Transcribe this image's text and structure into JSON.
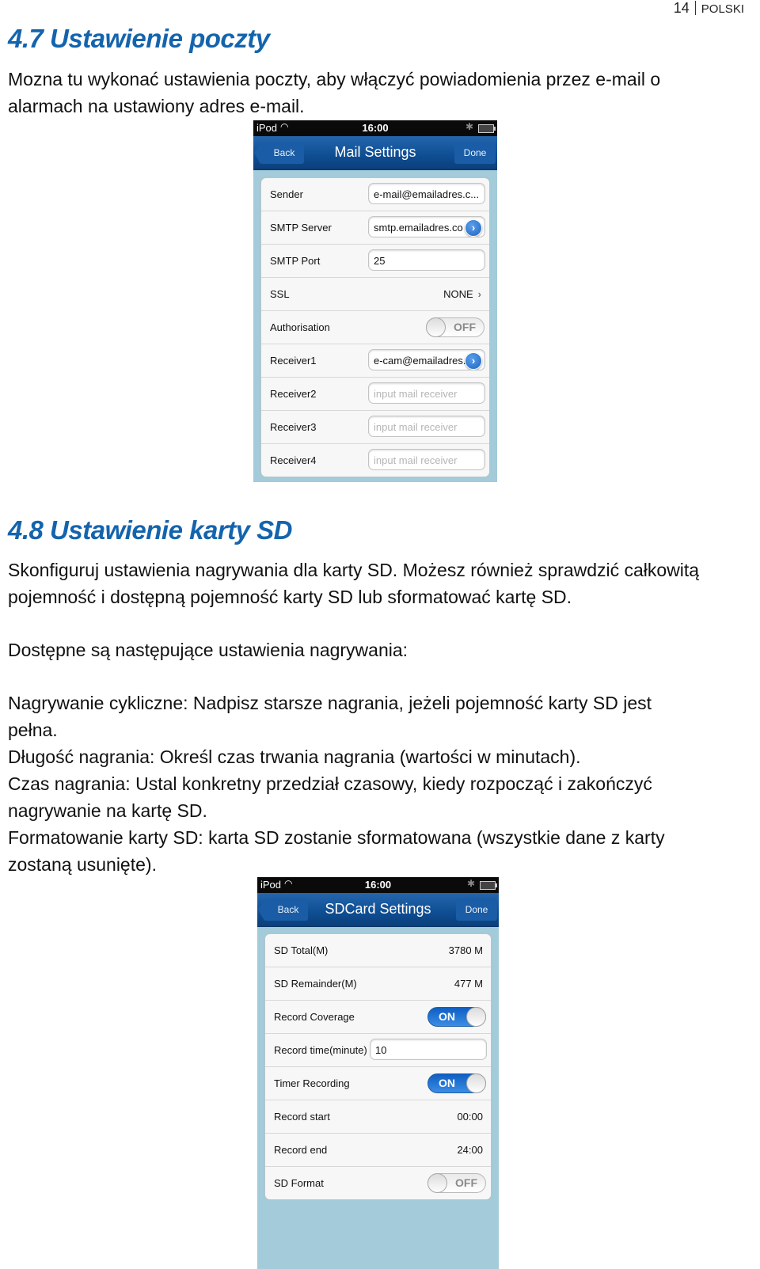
{
  "header": {
    "page_number": "14",
    "language": "POLSKI"
  },
  "section_mail": {
    "title": "4.7 Ustawienie poczty",
    "intro_line1": "Mozna tu wykonać ustawienia poczty, aby włączyć powiadomienia przez e-mail o",
    "intro_line2": "alarmach na ustawiony adres e-mail."
  },
  "mail_screen": {
    "status": {
      "carrier": "iPod",
      "time": "16:00"
    },
    "nav": {
      "back_label": "Back",
      "title": "Mail Settings",
      "done_label": "Done"
    },
    "rows": {
      "sender": {
        "label": "Sender",
        "value": "e-mail@emailadres.c..."
      },
      "smtp_server": {
        "label": "SMTP Server",
        "value": "smtp.emailadres.co"
      },
      "smtp_port": {
        "label": "SMTP Port",
        "value": "25"
      },
      "ssl": {
        "label": "SSL",
        "value": "NONE"
      },
      "authorisation": {
        "label": "Authorisation",
        "state": "OFF"
      },
      "receiver1": {
        "label": "Receiver1",
        "value": "e-cam@emailadres."
      },
      "receiver2": {
        "label": "Receiver2",
        "placeholder": "input mail receiver"
      },
      "receiver3": {
        "label": "Receiver3",
        "placeholder": "input mail receiver"
      },
      "receiver4": {
        "label": "Receiver4",
        "placeholder": "input mail receiver"
      }
    }
  },
  "section_sd": {
    "title": "4.8 Ustawienie karty SD",
    "intro_line1": "Skonfiguruj ustawienia nagrywania dla karty SD. Możesz również sprawdzić całkowitą",
    "intro_line2": "pojemność i dostępną pojemność karty SD lub sformatować kartę SD.",
    "available_heading": "Dostępne są następujące ustawienia nagrywania:",
    "lines": [
      "Nagrywanie cykliczne: Nadpisz starsze nagrania, jeżeli pojemność karty SD jest",
      "pełna.",
      "Długość nagrania: Określ czas trwania nagrania (wartości w minutach).",
      "Czas nagrania: Ustal konkretny przedział czasowy, kiedy rozpocząć i zakończyć",
      "nagrywanie na kartę SD.",
      "Formatowanie karty SD: karta SD zostanie sformatowana (wszystkie dane z karty",
      "zostaną usunięte)."
    ]
  },
  "sd_screen": {
    "status": {
      "carrier": "iPod",
      "time": "16:00"
    },
    "nav": {
      "back_label": "Back",
      "title": "SDCard Settings",
      "done_label": "Done"
    },
    "rows": {
      "sd_total": {
        "label": "SD Total(M)",
        "value": "3780 M"
      },
      "sd_remainder": {
        "label": "SD Remainder(M)",
        "value": "477 M"
      },
      "record_coverage": {
        "label": "Record Coverage",
        "state": "ON"
      },
      "record_time": {
        "label": "Record time(minute)",
        "value": "10"
      },
      "timer_recording": {
        "label": "Timer Recording",
        "state": "ON"
      },
      "record_start": {
        "label": "Record start",
        "value": "00:00"
      },
      "record_end": {
        "label": "Record end",
        "value": "24:00"
      },
      "sd_format": {
        "label": "SD Format",
        "state": "OFF"
      }
    }
  }
}
